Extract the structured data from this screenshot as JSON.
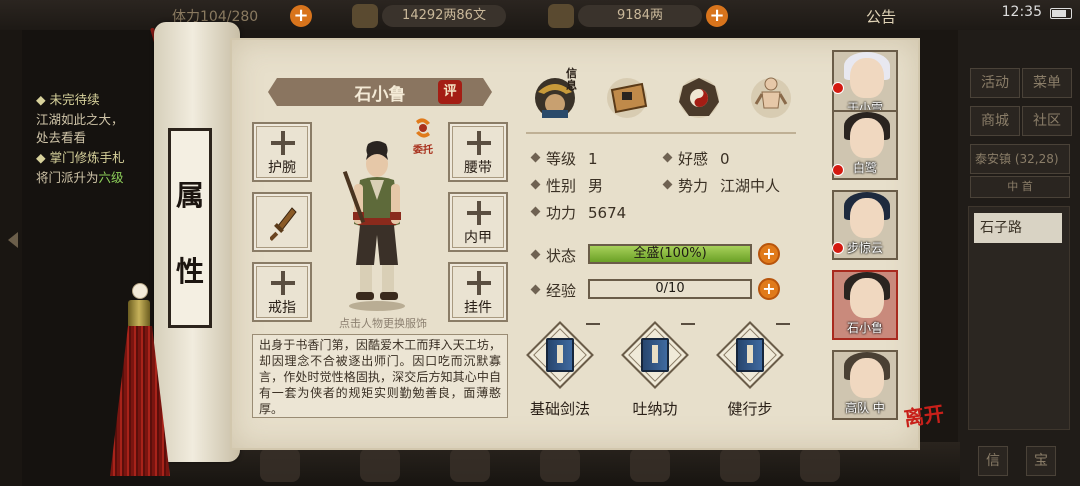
{
  "top_bar": {
    "stat_fragment": "体力104/280",
    "silver": "14292两86文",
    "gold": "9184两",
    "notice": "公告",
    "time": "12:35"
  },
  "quests": {
    "q1_title": "◆ 未完待续",
    "q1_line1": "江湖如此之大，",
    "q1_line2": "处去看看",
    "q2_title": "◆ 掌门修炼手札",
    "q2_line1_prefix": "将门派升为",
    "q2_line1_highlight": "六级"
  },
  "right_menu": {
    "activity": "活动",
    "menu": "菜单",
    "shop": "商城",
    "community": "社区",
    "town": "泰安镇",
    "coords": "(32,28)",
    "center": "中 首",
    "location": "石子路",
    "btn_a": "信",
    "btn_b": "宝"
  },
  "scroll": {
    "title_chars": [
      "属",
      "性"
    ]
  },
  "character": {
    "name": "石小鲁",
    "rating_badge": "评",
    "commission_label": "委托",
    "change_outfit_hint": "点击人物更换服饰",
    "bio": "出身于书香门第，因酷爱木工而拜入天工坊，却因理念不合被逐出师门。因口吃而沉默寡言，作处时觉性格固执，深交后方知其心中自有一套为侠者的规矩实则勤勉善良，面薄憨厚。"
  },
  "equipment_slots": {
    "wrist": "护腕",
    "belt": "腰带",
    "weapon": "",
    "armor": "内甲",
    "ring": "戒指",
    "pendant": "挂件"
  },
  "tabs": {
    "info_label": "信息",
    "icons": [
      "info-tab-icon",
      "bag-tab-icon",
      "bagua-tab-icon",
      "meridian-tab-icon"
    ]
  },
  "attributes": {
    "level_label": "等级",
    "level_value": "1",
    "favor_label": "好感",
    "favor_value": "0",
    "gender_label": "性别",
    "gender_value": "男",
    "faction_label": "势力",
    "faction_value": "江湖中人",
    "power_label": "功力",
    "power_value": "5674"
  },
  "status": {
    "state_label": "状态",
    "state_text": "全盛(100%)",
    "state_fraction": 1.0,
    "exp_label": "经验",
    "exp_text": "0/10",
    "exp_fraction": 0.0
  },
  "skills": [
    {
      "name": "基础剑法"
    },
    {
      "name": "吐纳功"
    },
    {
      "name": "健行步"
    }
  ],
  "party": [
    {
      "name": "于小雪",
      "alert": true
    },
    {
      "name": "白鹭",
      "alert": true
    },
    {
      "name": "步惊云",
      "alert": true
    },
    {
      "name": "石小鲁",
      "alert": false
    },
    {
      "name": "高队 中",
      "alert": false
    }
  ],
  "leave_label": "离开",
  "colors": {
    "accent_red": "#a41d14",
    "bar_green": "#6aa126",
    "plus_orange": "#e07a1a"
  }
}
